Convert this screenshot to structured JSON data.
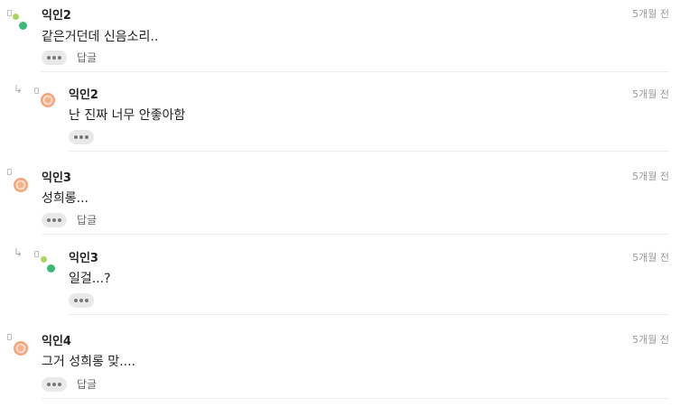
{
  "reply_label": "답글",
  "comments": [
    {
      "author": "익인2",
      "time": "5개월 전",
      "text": "같은거던데 신음소리..",
      "is_reply": false,
      "avatar": "green-dots",
      "has_reply_link": true
    },
    {
      "author": "익인2",
      "time": "5개월 전",
      "text": "난 진짜 너무 안좋아함",
      "is_reply": true,
      "avatar": "orange-ring",
      "has_reply_link": false
    },
    {
      "author": "익인3",
      "time": "5개월 전",
      "text": "성희롱...",
      "is_reply": false,
      "avatar": "orange-ring",
      "has_reply_link": true
    },
    {
      "author": "익인3",
      "time": "5개월 전",
      "text": "일걸...?",
      "is_reply": true,
      "avatar": "green-dots",
      "has_reply_link": false
    },
    {
      "author": "익인4",
      "time": "5개월 전",
      "text": "그거 성희롱 맞....",
      "is_reply": false,
      "avatar": "orange-ring",
      "has_reply_link": true
    }
  ],
  "colors": {
    "green_light": "#a6d75a",
    "green_dark": "#3cb878",
    "orange": "#f6a27a"
  }
}
